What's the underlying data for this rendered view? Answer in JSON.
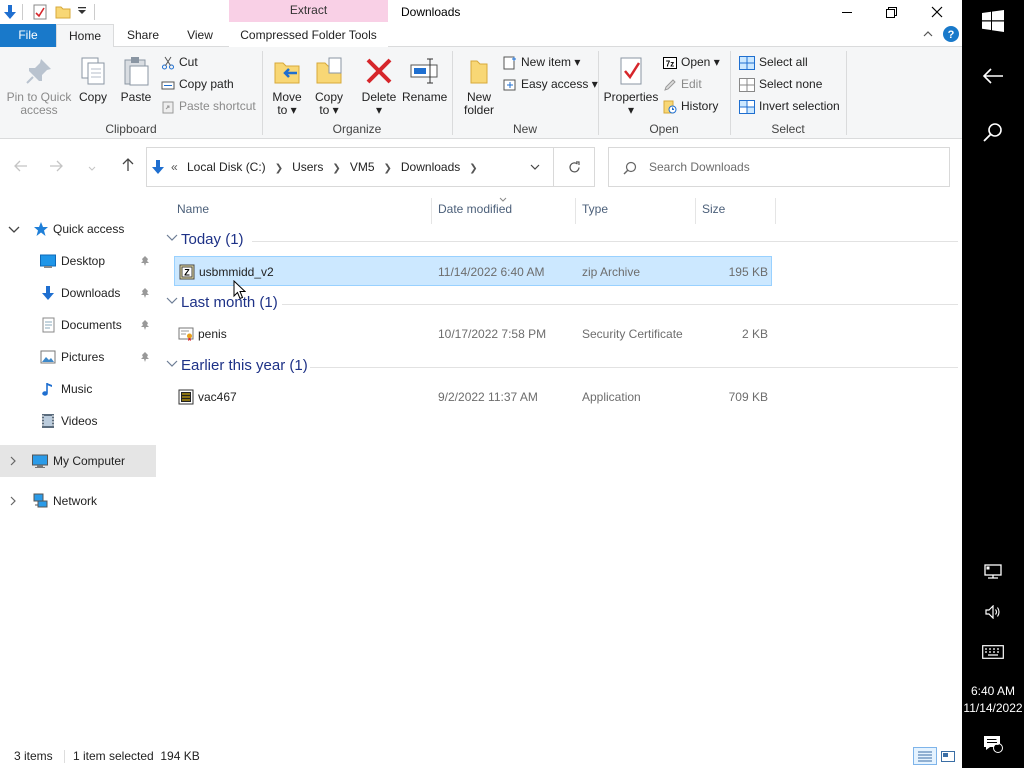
{
  "titlebar": {
    "context_tab_header": "Extract",
    "title": "Downloads",
    "minimize_glyph": "—",
    "restore_glyph": "❐",
    "close_glyph": "✕"
  },
  "tabs": {
    "file": "File",
    "home": "Home",
    "share": "Share",
    "view": "View",
    "compressed": "Compressed Folder Tools"
  },
  "ribbon": {
    "clipboard": {
      "label": "Clipboard",
      "pin_line1": "Pin to Quick",
      "pin_line2": "access",
      "copy": "Copy",
      "paste": "Paste",
      "cut": "Cut",
      "copy_path": "Copy path",
      "paste_shortcut": "Paste shortcut"
    },
    "organize": {
      "label": "Organize",
      "move_line1": "Move",
      "move_line2": "to",
      "copy_line1": "Copy",
      "copy_line2": "to",
      "delete": "Delete",
      "rename": "Rename"
    },
    "new": {
      "label": "New",
      "folder_line1": "New",
      "folder_line2": "folder",
      "new_item": "New item",
      "easy_access": "Easy access"
    },
    "open": {
      "label": "Open",
      "properties": "Properties",
      "open": "Open",
      "edit": "Edit",
      "history": "History"
    },
    "select": {
      "label": "Select",
      "select_all": "Select all",
      "select_none": "Select none",
      "invert": "Invert selection"
    }
  },
  "address": {
    "overflow": "«",
    "crumbs": [
      "Local Disk (C:)",
      "Users",
      "VM5",
      "Downloads"
    ],
    "search_placeholder": "Search Downloads"
  },
  "navpane": {
    "quick_access": "Quick access",
    "desktop": "Desktop",
    "downloads": "Downloads",
    "documents": "Documents",
    "pictures": "Pictures",
    "music": "Music",
    "videos": "Videos",
    "my_computer": "My Computer",
    "network": "Network"
  },
  "columns": {
    "name": "Name",
    "date": "Date modified",
    "type": "Type",
    "size": "Size"
  },
  "groups": [
    {
      "title": "Today (1)",
      "file": {
        "name": "usbmmidd_v2",
        "date": "11/14/2022 6:40 AM",
        "type": "zip Archive",
        "size": "195 KB",
        "icon": "zip-icon",
        "selected": true
      }
    },
    {
      "title": "Last month (1)",
      "file": {
        "name": "penis",
        "date": "10/17/2022 7:58 PM",
        "type": "Security Certificate",
        "size": "2 KB",
        "icon": "certificate-icon",
        "selected": false
      }
    },
    {
      "title": "Earlier this year (1)",
      "file": {
        "name": "vac467",
        "date": "9/2/2022 11:37 AM",
        "type": "Application",
        "size": "709 KB",
        "icon": "application-icon",
        "selected": false
      }
    }
  ],
  "status": {
    "items": "3 items",
    "selected": "1 item selected  194 KB"
  },
  "tabletbar": {
    "time": "6:40 AM",
    "date": "11/14/2022",
    "notifications": "1"
  },
  "colors": {
    "accent": "#1979ca",
    "selection": "#cce8ff",
    "context_tab": "#f9d0e6",
    "group_title": "#1e3287"
  }
}
